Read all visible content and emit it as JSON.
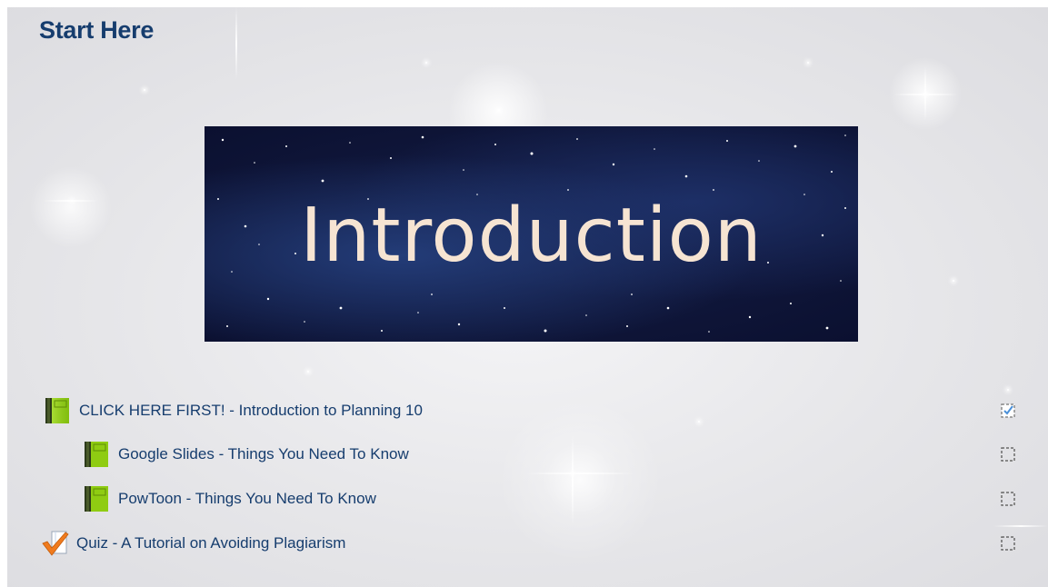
{
  "section": {
    "title": "Start Here"
  },
  "banner": {
    "text": "Introduction"
  },
  "activities": [
    {
      "label": "CLICK HERE FIRST! - Introduction to Planning 10",
      "icon": "book-icon",
      "completed": true
    },
    {
      "label": "Google Slides - Things You Need To Know",
      "icon": "book-icon",
      "completed": false
    },
    {
      "label": "PowToon - Things You Need To Know",
      "icon": "book-icon",
      "completed": false
    },
    {
      "label": "Quiz - A Tutorial on Avoiding Plagiarism",
      "icon": "quiz-checkmark-icon",
      "completed": false
    }
  ],
  "colors": {
    "link": "#163d6e",
    "title": "#163d6e",
    "banner_text": "#f6e4d2",
    "book_green": "#8fcc12",
    "quiz_check": "#f07b1e",
    "completed_check": "#4a8fd8"
  }
}
